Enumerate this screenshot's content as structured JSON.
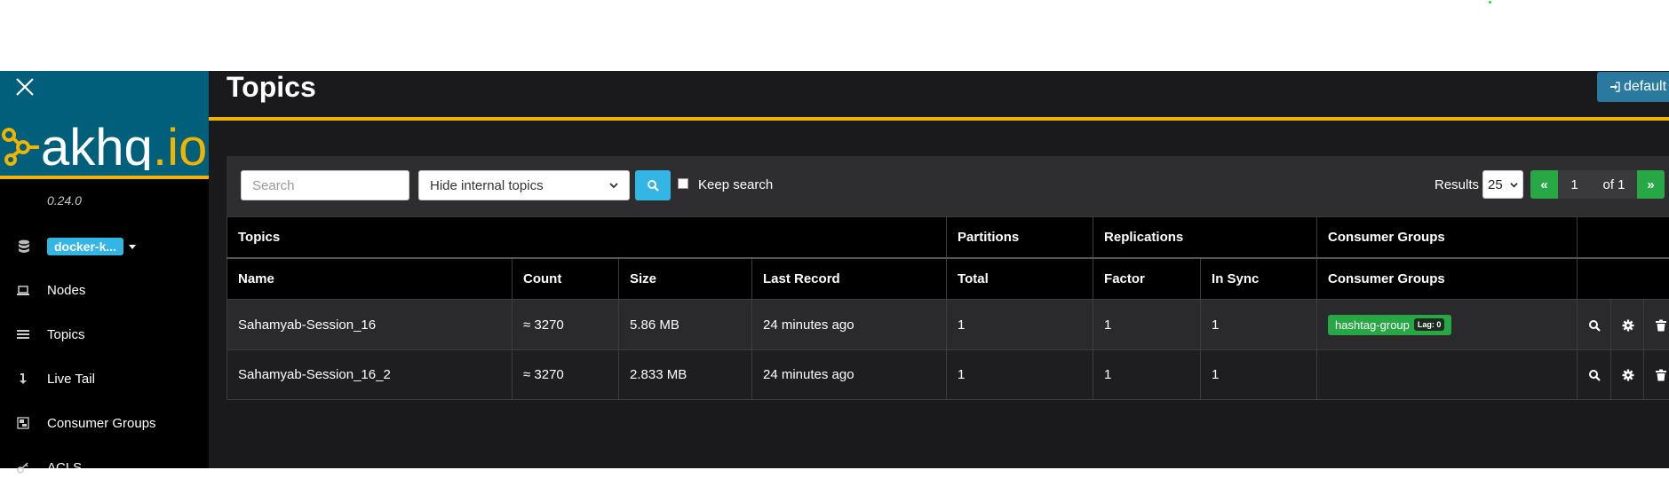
{
  "sidebar": {
    "logo_text": "akhq.io",
    "version": "0.24.0",
    "cluster": "docker-k...",
    "items": [
      {
        "label": "Nodes",
        "icon": "laptop-icon"
      },
      {
        "label": "Topics",
        "icon": "list-icon"
      },
      {
        "label": "Live Tail",
        "icon": "level-down-icon"
      },
      {
        "label": "Consumer Groups",
        "icon": "object-group-icon"
      },
      {
        "label": "ACLS",
        "icon": "key-icon"
      }
    ]
  },
  "header": {
    "title": "Topics",
    "user_button": "default"
  },
  "toolbar": {
    "search_placeholder": "Search",
    "filter_value": "Hide internal topics",
    "keep_search_label": "Keep search",
    "results_label": "Results",
    "results_value": "25",
    "pager": {
      "prev": "«",
      "page": "1",
      "of": "of 1",
      "next": "»"
    }
  },
  "table": {
    "group_headers": [
      "Topics",
      "Partitions",
      "Replications",
      "Consumer Groups"
    ],
    "columns": [
      "Name",
      "Count",
      "Size",
      "Last Record",
      "Total",
      "Factor",
      "In Sync",
      "Consumer Groups"
    ],
    "rows": [
      {
        "name": "Sahamyab-Session_16",
        "count": "≈ 3270",
        "size": "5.86 MB",
        "last_record": "24 minutes ago",
        "total": "1",
        "factor": "1",
        "in_sync": "1",
        "consumer_group": "hashtag-group",
        "lag": "Lag: 0"
      },
      {
        "name": "Sahamyab-Session_16_2",
        "count": "≈ 3270",
        "size": "2.833 MB",
        "last_record": "24 minutes ago",
        "total": "1",
        "factor": "1",
        "in_sync": "1",
        "consumer_group": "",
        "lag": ""
      }
    ]
  },
  "colors": {
    "accent_yellow": "#f0b400",
    "brand_teal": "#005f7a",
    "info_blue": "#33b5e5",
    "success_green": "#28a745"
  }
}
